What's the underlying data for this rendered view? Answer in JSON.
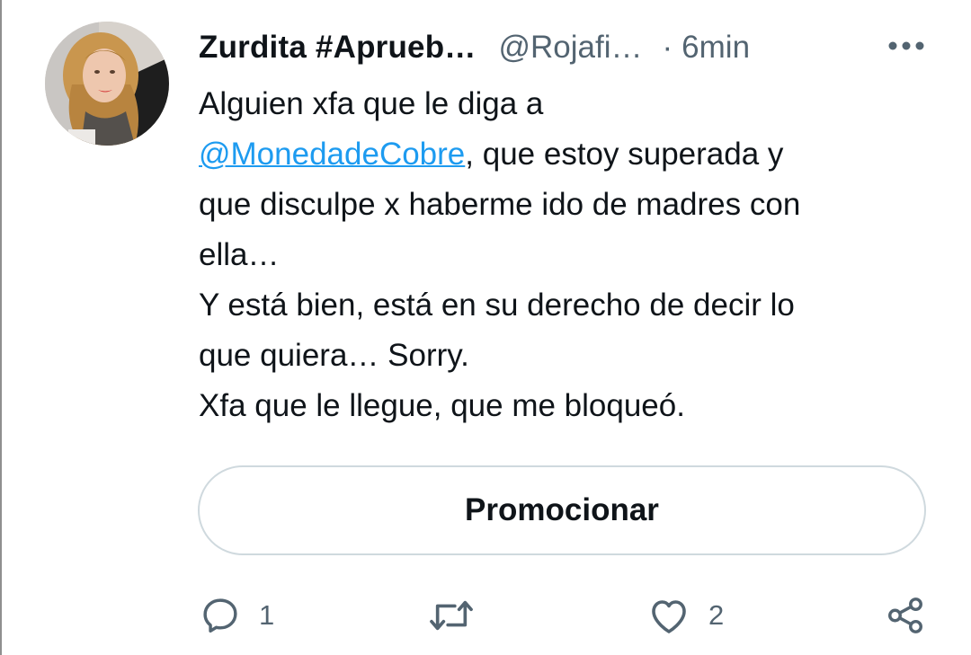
{
  "tweet": {
    "display_name": "Zurdita #Aprueb…",
    "handle": "@Rojafi…",
    "separator": "·",
    "time": "6min",
    "text_lines": [
      {
        "before": "Alguien xfa que le diga a",
        "mention": "",
        "after": ""
      },
      {
        "before": "",
        "mention": "@MonedadeCobre",
        "after": ", que estoy superada y"
      },
      {
        "before": "que disculpe x haberme ido de madres con",
        "mention": "",
        "after": ""
      },
      {
        "before": "ella…",
        "mention": "",
        "after": ""
      },
      {
        "before": "Y está bien, está en su derecho de decir lo",
        "mention": "",
        "after": ""
      },
      {
        "before": "que quiera… Sorry.",
        "mention": "",
        "after": ""
      },
      {
        "before": "Xfa que le llegue, que me bloqueó.",
        "mention": "",
        "after": ""
      }
    ],
    "promote_label": "Promocionar",
    "actions": {
      "reply_count": "1",
      "retweet_count": "",
      "like_count": "2"
    }
  },
  "icons": {
    "more": "more-horizontal-icon",
    "reply": "reply-icon",
    "retweet": "retweet-icon",
    "like": "heart-icon",
    "share": "share-icon"
  },
  "colors": {
    "text": "#0f1419",
    "secondary": "#536471",
    "link": "#1d9bf0",
    "border": "#cfd9de"
  }
}
